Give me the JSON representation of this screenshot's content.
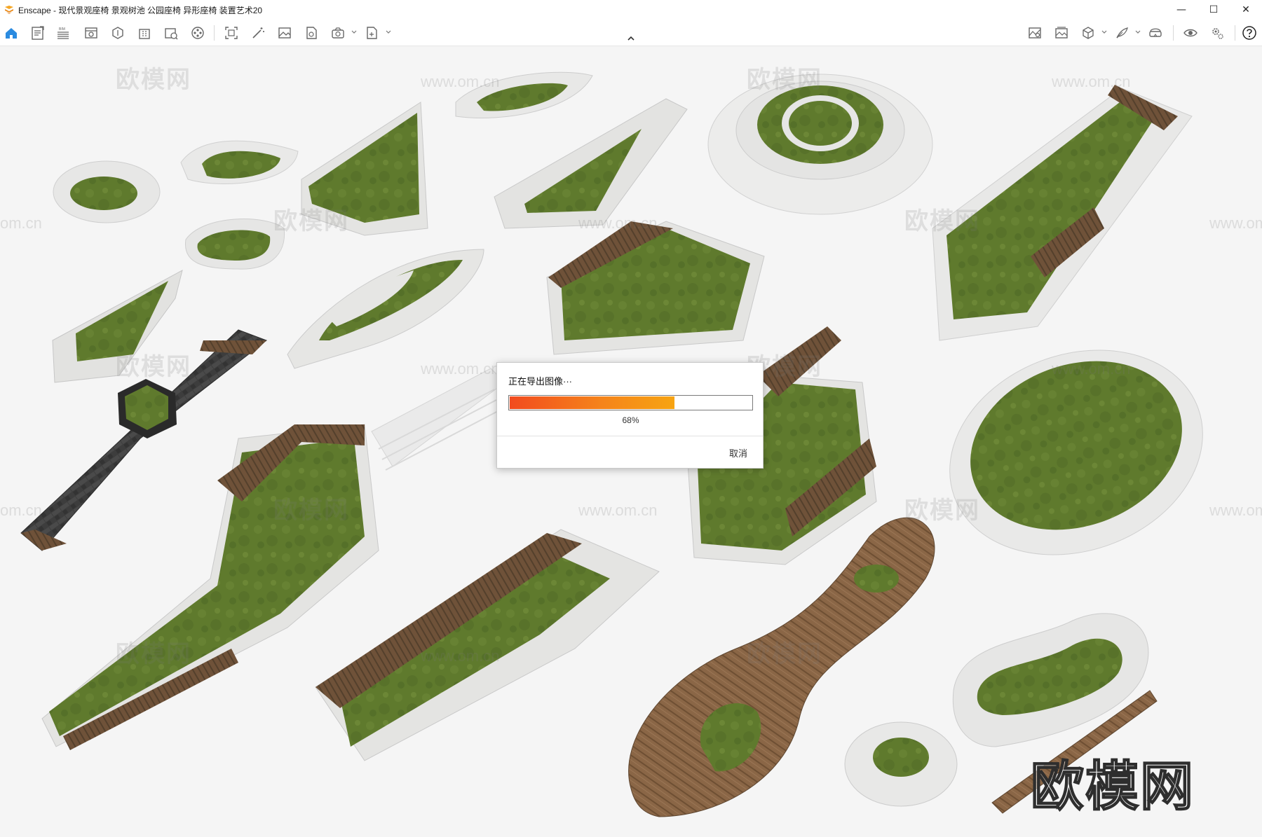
{
  "window": {
    "app_name": "Enscape",
    "title": "Enscape - 现代景观座椅 景观树池 公园座椅 异形座椅 装置艺术20",
    "controls": {
      "minimize": "—",
      "maximize": "☐",
      "close": "✕"
    }
  },
  "toolbar": {
    "left_icons": [
      "home-icon",
      "notes-icon",
      "bim-list-icon",
      "view-icon",
      "material-icon",
      "building-icon",
      "object-info-icon",
      "video-icon",
      "frame-icon",
      "magic-wand-icon",
      "image-icon",
      "asset-icon",
      "export-icon",
      "batch-export-icon"
    ],
    "right_icons": [
      "atmosphere-icon",
      "gallery-icon",
      "cube-view-icon",
      "feather-icon",
      "vr-headset-icon",
      "visibility-icon",
      "settings-icon",
      "help-icon"
    ]
  },
  "dialog": {
    "title": "正在导出图像···",
    "progress_percent": 68,
    "progress_label": "68%",
    "cancel_label": "取消"
  },
  "viewport": {
    "watermark_text": "欧模网",
    "watermark_url": "www.om.cn",
    "watermark_url_short": "om.cn",
    "brand_mark": "欧模网"
  },
  "colors": {
    "accent_orange": "#f5831a",
    "grass": "#5f7a2d",
    "concrete": "#e4e4e2",
    "wood": "#7a5a3c"
  }
}
